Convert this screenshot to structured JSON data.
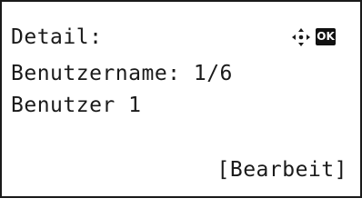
{
  "screen": {
    "title": "Detail:",
    "line2": "Benutzername: 1/6",
    "line3": "Benutzer 1",
    "softkey_label": "[Bearbeit]"
  },
  "indicators": {
    "nav_icon": "four-way-arrow-icon",
    "ok_label": "OK"
  },
  "colors": {
    "foreground": "#1a1a1a",
    "background": "#ffffff"
  }
}
